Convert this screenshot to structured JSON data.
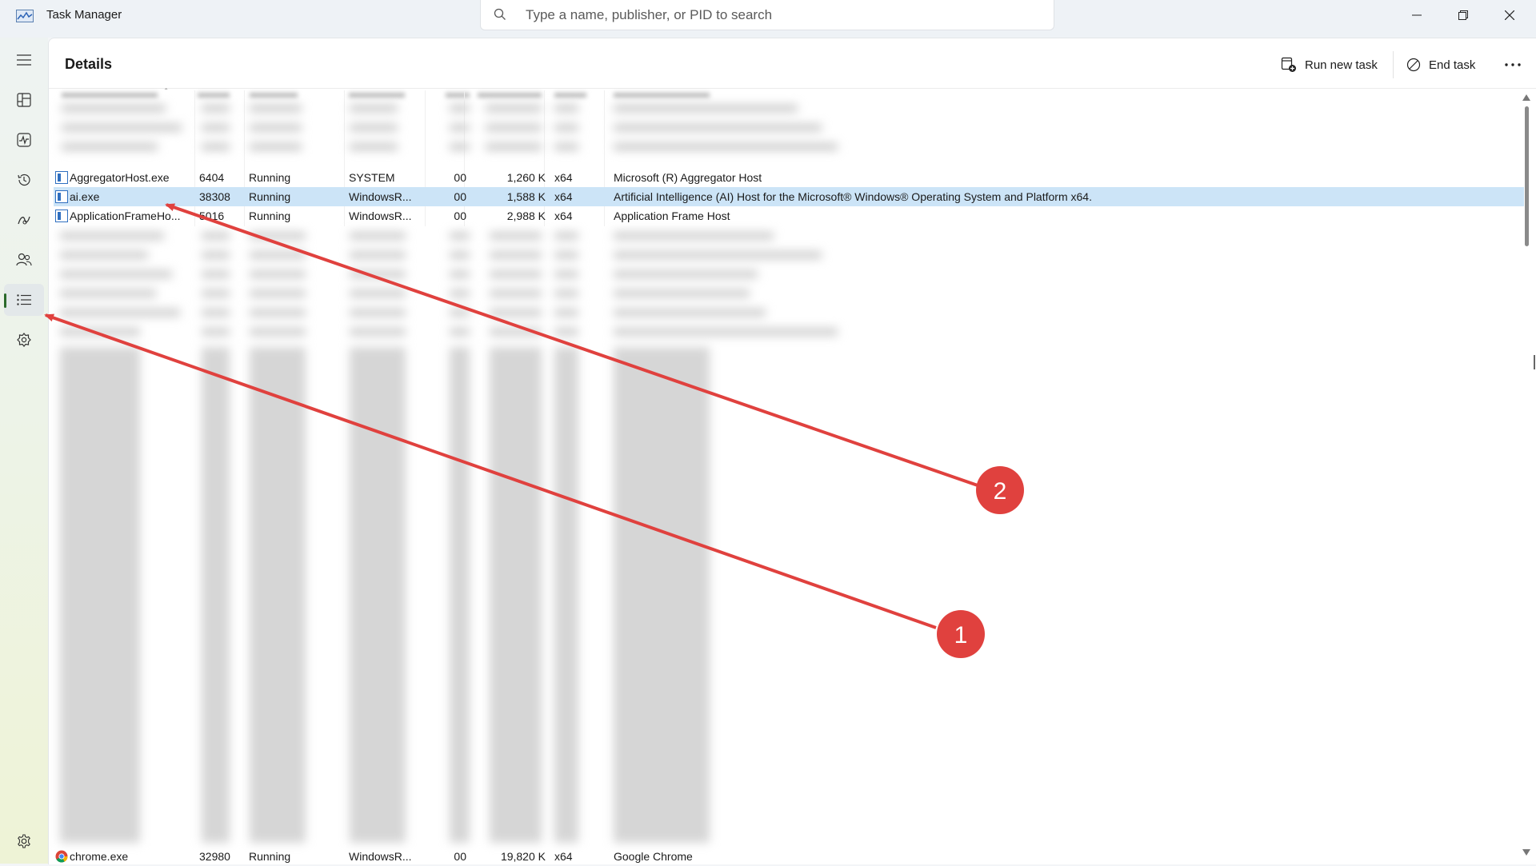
{
  "window": {
    "title": "Task Manager",
    "buttons": [
      "minimize",
      "restore",
      "close"
    ]
  },
  "search": {
    "placeholder": "Type a name, publisher, or PID to search"
  },
  "sidebar": {
    "items": [
      {
        "icon": "hamburger-menu-icon"
      },
      {
        "icon": "processes-icon"
      },
      {
        "icon": "performance-icon"
      },
      {
        "icon": "app-history-icon"
      },
      {
        "icon": "startup-apps-icon"
      },
      {
        "icon": "users-icon"
      },
      {
        "icon": "details-icon",
        "active": true
      },
      {
        "icon": "services-icon"
      }
    ],
    "settings_icon": "gear-icon"
  },
  "main": {
    "title": "Details",
    "commands": {
      "run_new_task": "Run new task",
      "end_task": "End task",
      "more": "more-options-icon"
    },
    "rows": [
      {
        "name": "AggregatorHost.exe",
        "pid": "6404",
        "status": "Running",
        "user": "SYSTEM",
        "cpu": "00",
        "memory": "1,260 K",
        "arch": "x64",
        "description": "Microsoft (R) Aggregator Host",
        "selected": false
      },
      {
        "name": "ai.exe",
        "pid": "38308",
        "status": "Running",
        "user": "WindowsR...",
        "cpu": "00",
        "memory": "1,588 K",
        "arch": "x64",
        "description": "Artificial Intelligence (AI) Host for the Microsoft® Windows® Operating System and Platform x64.",
        "selected": true
      },
      {
        "name": "ApplicationFrameHo...",
        "pid": "5016",
        "status": "Running",
        "user": "WindowsR...",
        "cpu": "00",
        "memory": "2,988 K",
        "arch": "x64",
        "description": "Application Frame Host",
        "selected": false
      },
      {
        "name": "chrome.exe",
        "pid": "32980",
        "status": "Running",
        "user": "WindowsR...",
        "cpu": "00",
        "memory": "19,820 K",
        "arch": "x64",
        "description": "Google Chrome",
        "selected": false
      }
    ]
  },
  "annotations": {
    "markers": [
      {
        "label": "1",
        "points_to": "details-nav"
      },
      {
        "label": "2",
        "points_to": "ai.exe row"
      }
    ],
    "color": "#e0413e"
  }
}
